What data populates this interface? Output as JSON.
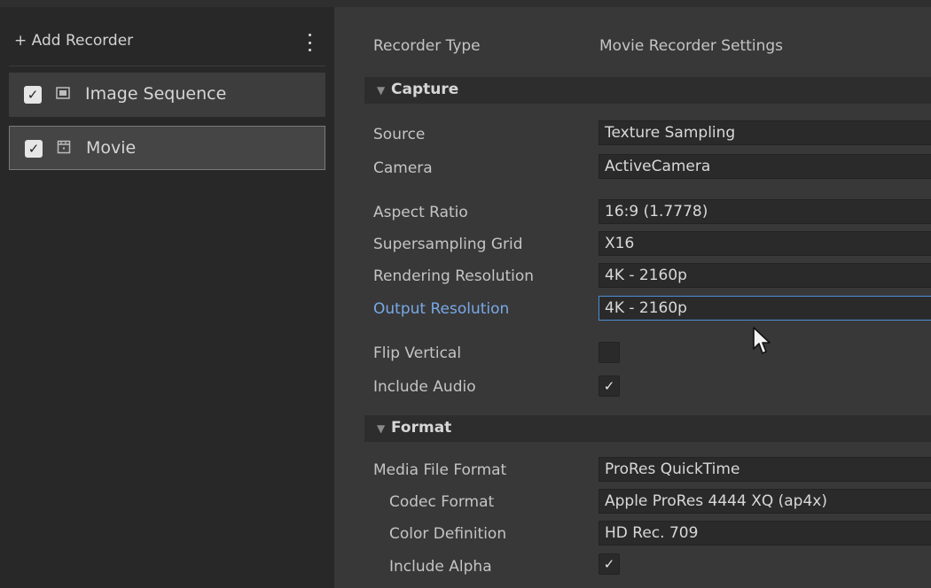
{
  "sidebar": {
    "add_recorder_label": "+ Add Recorder",
    "recorders": [
      {
        "label": "Image Sequence",
        "enabled": true,
        "icon": "image-icon"
      },
      {
        "label": "Movie",
        "enabled": true,
        "icon": "movie-icon",
        "selected": true
      }
    ]
  },
  "inspector": {
    "recorder_type_label": "Recorder Type",
    "recorder_type_value": "Movie Recorder Settings",
    "capture": {
      "title": "Capture",
      "source_label": "Source",
      "source_value": "Texture Sampling",
      "camera_label": "Camera",
      "camera_value": "ActiveCamera",
      "aspect_ratio_label": "Aspect Ratio",
      "aspect_ratio_value": "16:9 (1.7778)",
      "supersampling_label": "Supersampling Grid",
      "supersampling_value": "X16",
      "rendering_resolution_label": "Rendering Resolution",
      "rendering_resolution_value": "4K - 2160p",
      "output_resolution_label": "Output Resolution",
      "output_resolution_value": "4K - 2160p",
      "flip_vertical_label": "Flip Vertical",
      "flip_vertical_checked": false,
      "include_audio_label": "Include Audio",
      "include_audio_checked": true
    },
    "format": {
      "title": "Format",
      "media_file_format_label": "Media File Format",
      "media_file_format_value": "ProRes QuickTime",
      "codec_format_label": "Codec Format",
      "codec_format_value": "Apple ProRes 4444 XQ (ap4x)",
      "color_definition_label": "Color Definition",
      "color_definition_value": "HD Rec. 709",
      "include_alpha_label": "Include Alpha",
      "include_alpha_checked": true
    }
  },
  "glyphs": {
    "check": "✓",
    "triangle": "▼"
  },
  "colors": {
    "accent_blue": "#78a9e6",
    "focus_border": "#4e8cd6"
  }
}
